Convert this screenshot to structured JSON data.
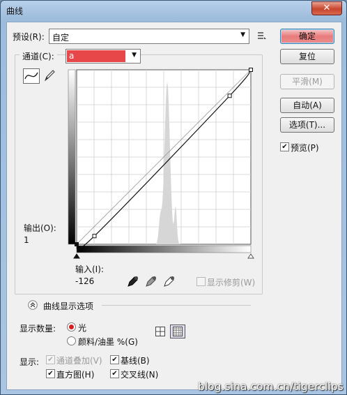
{
  "window": {
    "title": "曲线",
    "close": "✕"
  },
  "preset": {
    "label": "预设(R):",
    "value": "自定"
  },
  "channel": {
    "label": "通道(C):",
    "value": "a"
  },
  "buttons": {
    "ok": "确定",
    "reset": "复位",
    "smooth": "平滑(M)",
    "auto": "自动(A)",
    "options": "选项(T)..."
  },
  "preview": {
    "label": "预览(P)",
    "checked": true
  },
  "output": {
    "label": "输出(O):",
    "value": "1"
  },
  "input": {
    "label": "输入(I):",
    "value": "-126"
  },
  "show_clipping": {
    "label": "显示修剪(W)",
    "checked": false
  },
  "curve_options": {
    "label": "曲线显示选项"
  },
  "show_amount": {
    "label": "显示数量:",
    "options": [
      {
        "label": "光",
        "selected": true
      },
      {
        "label": "颜料/油墨 %(G)",
        "selected": false
      }
    ]
  },
  "display": {
    "label": "显示:",
    "items": [
      {
        "label": "通道叠加(V)",
        "checked": true,
        "disabled": true
      },
      {
        "label": "基线(B)",
        "checked": true,
        "disabled": false
      },
      {
        "label": "直方图(H)",
        "checked": true,
        "disabled": false
      },
      {
        "label": "交叉线(N)",
        "checked": true,
        "disabled": false
      }
    ]
  },
  "icons": {
    "curve_tool": "curve-icon",
    "pencil_tool": "pencil-icon",
    "preset_menu": "list-menu-icon",
    "black_point": "black-eyedropper-icon",
    "gray_point": "gray-eyedropper-icon",
    "white_point": "white-eyedropper-icon",
    "grid_small": "grid-4-icon",
    "grid_large": "grid-10-icon",
    "collapse": "double-chevron-up-icon"
  },
  "colors": {
    "channel_swatch": "#e8474a",
    "ok_button": "#e87b7b"
  },
  "curve": {
    "points": [
      [
        0,
        0
      ],
      [
        26,
        12
      ],
      [
        224,
        217
      ],
      [
        255,
        255
      ]
    ],
    "range": [
      0,
      255
    ]
  },
  "watermark": "blog.sina.com.cn/tigerclips"
}
